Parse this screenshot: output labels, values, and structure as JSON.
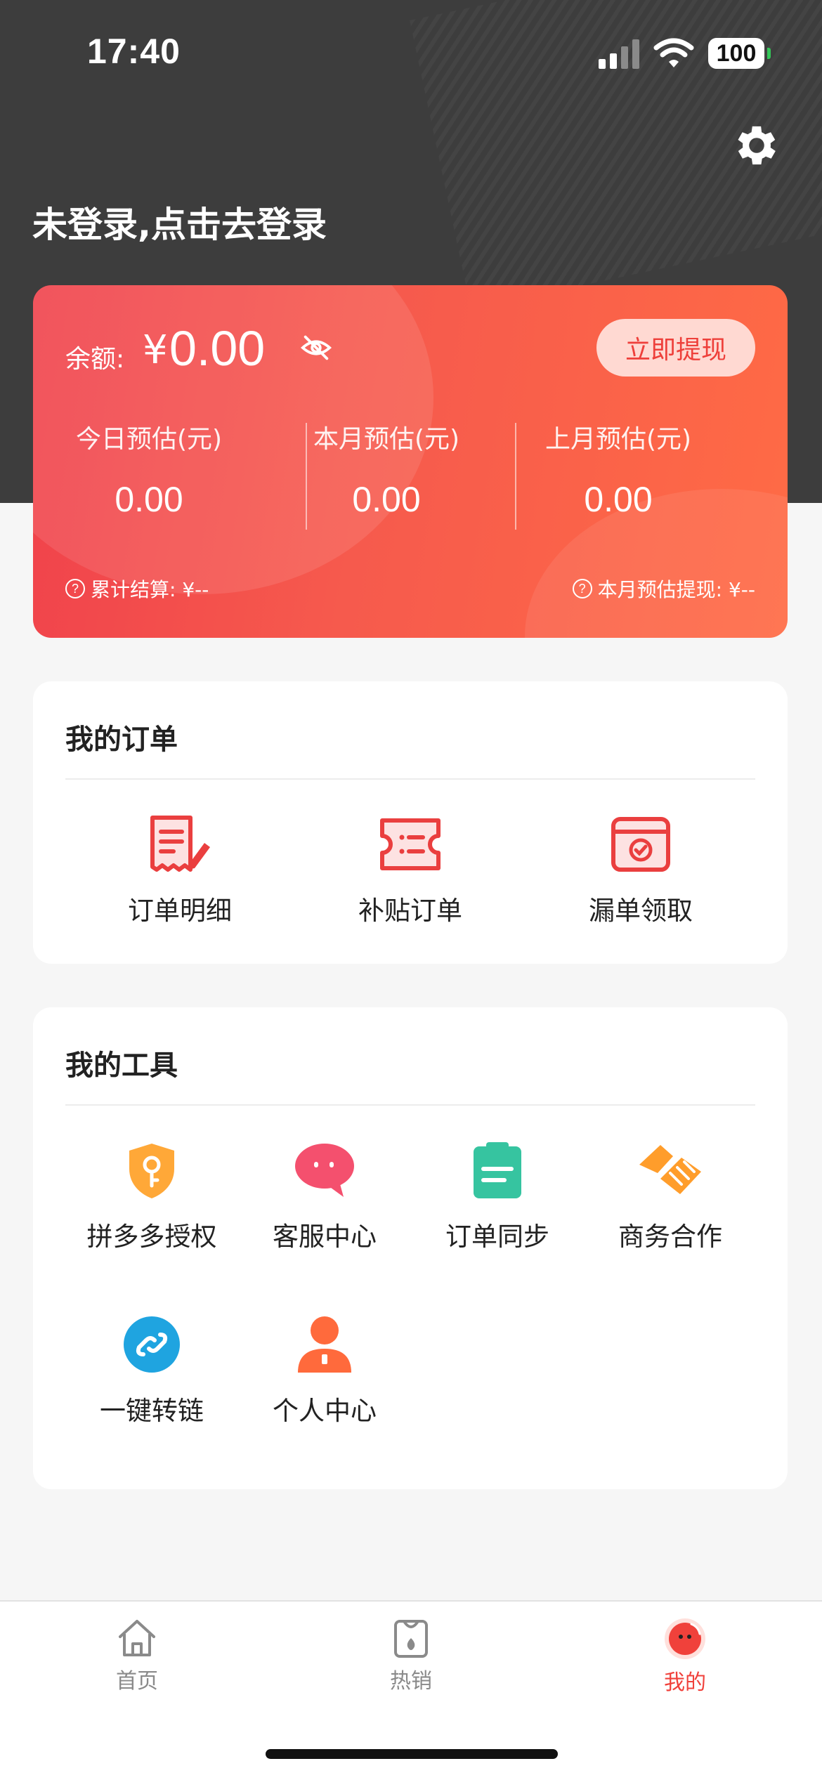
{
  "status_bar": {
    "time": "17:40",
    "battery": "100"
  },
  "header": {
    "login_text": "未登录,点击去登录"
  },
  "balance": {
    "label": "余额:",
    "currency": "¥",
    "value": "0.00",
    "withdraw_button": "立即提现",
    "stats": [
      {
        "label": "今日预估(元)",
        "value": "0.00"
      },
      {
        "label": "本月预估(元)",
        "value": "0.00"
      },
      {
        "label": "上月预估(元)",
        "value": "0.00"
      }
    ],
    "footer_left": "累计结算: ¥--",
    "footer_right": "本月预估提现: ¥--"
  },
  "orders": {
    "title": "我的订单",
    "items": [
      {
        "label": "订单明细",
        "icon": "order-detail-icon"
      },
      {
        "label": "补贴订单",
        "icon": "ticket-icon"
      },
      {
        "label": "漏单领取",
        "icon": "box-check-icon"
      }
    ]
  },
  "tools": {
    "title": "我的工具",
    "items": [
      {
        "label": "拼多多授权",
        "icon": "shield-key-icon"
      },
      {
        "label": "客服中心",
        "icon": "chat-bubble-icon"
      },
      {
        "label": "订单同步",
        "icon": "clipboard-icon"
      },
      {
        "label": "商务合作",
        "icon": "handshake-icon"
      },
      {
        "label": "一键转链",
        "icon": "link-icon"
      },
      {
        "label": "个人中心",
        "icon": "user-icon"
      }
    ]
  },
  "tabbar": {
    "items": [
      {
        "label": "首页",
        "icon": "home-icon"
      },
      {
        "label": "热销",
        "icon": "hot-sale-icon"
      },
      {
        "label": "我的",
        "icon": "profile-avatar-icon"
      }
    ],
    "active_index": 2,
    "active_color": "#f0413b",
    "inactive_color": "#8a8a8a"
  },
  "colors": {
    "header_bg": "#3d3d3d",
    "accent": "#f0413b"
  }
}
